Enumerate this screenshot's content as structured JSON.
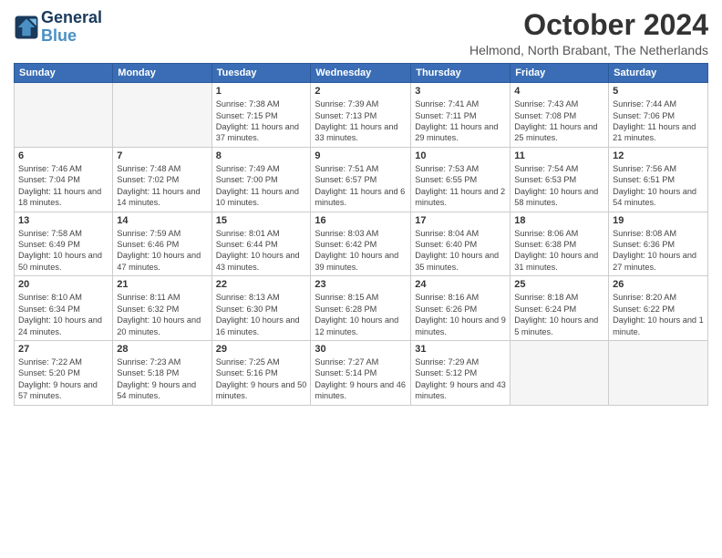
{
  "header": {
    "logo_line1": "General",
    "logo_line2": "Blue",
    "month": "October 2024",
    "location": "Helmond, North Brabant, The Netherlands"
  },
  "days_of_week": [
    "Sunday",
    "Monday",
    "Tuesday",
    "Wednesday",
    "Thursday",
    "Friday",
    "Saturday"
  ],
  "weeks": [
    [
      {
        "day": "",
        "detail": ""
      },
      {
        "day": "",
        "detail": ""
      },
      {
        "day": "1",
        "detail": "Sunrise: 7:38 AM\nSunset: 7:15 PM\nDaylight: 11 hours and 37 minutes."
      },
      {
        "day": "2",
        "detail": "Sunrise: 7:39 AM\nSunset: 7:13 PM\nDaylight: 11 hours and 33 minutes."
      },
      {
        "day": "3",
        "detail": "Sunrise: 7:41 AM\nSunset: 7:11 PM\nDaylight: 11 hours and 29 minutes."
      },
      {
        "day": "4",
        "detail": "Sunrise: 7:43 AM\nSunset: 7:08 PM\nDaylight: 11 hours and 25 minutes."
      },
      {
        "day": "5",
        "detail": "Sunrise: 7:44 AM\nSunset: 7:06 PM\nDaylight: 11 hours and 21 minutes."
      }
    ],
    [
      {
        "day": "6",
        "detail": "Sunrise: 7:46 AM\nSunset: 7:04 PM\nDaylight: 11 hours and 18 minutes."
      },
      {
        "day": "7",
        "detail": "Sunrise: 7:48 AM\nSunset: 7:02 PM\nDaylight: 11 hours and 14 minutes."
      },
      {
        "day": "8",
        "detail": "Sunrise: 7:49 AM\nSunset: 7:00 PM\nDaylight: 11 hours and 10 minutes."
      },
      {
        "day": "9",
        "detail": "Sunrise: 7:51 AM\nSunset: 6:57 PM\nDaylight: 11 hours and 6 minutes."
      },
      {
        "day": "10",
        "detail": "Sunrise: 7:53 AM\nSunset: 6:55 PM\nDaylight: 11 hours and 2 minutes."
      },
      {
        "day": "11",
        "detail": "Sunrise: 7:54 AM\nSunset: 6:53 PM\nDaylight: 10 hours and 58 minutes."
      },
      {
        "day": "12",
        "detail": "Sunrise: 7:56 AM\nSunset: 6:51 PM\nDaylight: 10 hours and 54 minutes."
      }
    ],
    [
      {
        "day": "13",
        "detail": "Sunrise: 7:58 AM\nSunset: 6:49 PM\nDaylight: 10 hours and 50 minutes."
      },
      {
        "day": "14",
        "detail": "Sunrise: 7:59 AM\nSunset: 6:46 PM\nDaylight: 10 hours and 47 minutes."
      },
      {
        "day": "15",
        "detail": "Sunrise: 8:01 AM\nSunset: 6:44 PM\nDaylight: 10 hours and 43 minutes."
      },
      {
        "day": "16",
        "detail": "Sunrise: 8:03 AM\nSunset: 6:42 PM\nDaylight: 10 hours and 39 minutes."
      },
      {
        "day": "17",
        "detail": "Sunrise: 8:04 AM\nSunset: 6:40 PM\nDaylight: 10 hours and 35 minutes."
      },
      {
        "day": "18",
        "detail": "Sunrise: 8:06 AM\nSunset: 6:38 PM\nDaylight: 10 hours and 31 minutes."
      },
      {
        "day": "19",
        "detail": "Sunrise: 8:08 AM\nSunset: 6:36 PM\nDaylight: 10 hours and 27 minutes."
      }
    ],
    [
      {
        "day": "20",
        "detail": "Sunrise: 8:10 AM\nSunset: 6:34 PM\nDaylight: 10 hours and 24 minutes."
      },
      {
        "day": "21",
        "detail": "Sunrise: 8:11 AM\nSunset: 6:32 PM\nDaylight: 10 hours and 20 minutes."
      },
      {
        "day": "22",
        "detail": "Sunrise: 8:13 AM\nSunset: 6:30 PM\nDaylight: 10 hours and 16 minutes."
      },
      {
        "day": "23",
        "detail": "Sunrise: 8:15 AM\nSunset: 6:28 PM\nDaylight: 10 hours and 12 minutes."
      },
      {
        "day": "24",
        "detail": "Sunrise: 8:16 AM\nSunset: 6:26 PM\nDaylight: 10 hours and 9 minutes."
      },
      {
        "day": "25",
        "detail": "Sunrise: 8:18 AM\nSunset: 6:24 PM\nDaylight: 10 hours and 5 minutes."
      },
      {
        "day": "26",
        "detail": "Sunrise: 8:20 AM\nSunset: 6:22 PM\nDaylight: 10 hours and 1 minute."
      }
    ],
    [
      {
        "day": "27",
        "detail": "Sunrise: 7:22 AM\nSunset: 5:20 PM\nDaylight: 9 hours and 57 minutes."
      },
      {
        "day": "28",
        "detail": "Sunrise: 7:23 AM\nSunset: 5:18 PM\nDaylight: 9 hours and 54 minutes."
      },
      {
        "day": "29",
        "detail": "Sunrise: 7:25 AM\nSunset: 5:16 PM\nDaylight: 9 hours and 50 minutes."
      },
      {
        "day": "30",
        "detail": "Sunrise: 7:27 AM\nSunset: 5:14 PM\nDaylight: 9 hours and 46 minutes."
      },
      {
        "day": "31",
        "detail": "Sunrise: 7:29 AM\nSunset: 5:12 PM\nDaylight: 9 hours and 43 minutes."
      },
      {
        "day": "",
        "detail": ""
      },
      {
        "day": "",
        "detail": ""
      }
    ]
  ]
}
